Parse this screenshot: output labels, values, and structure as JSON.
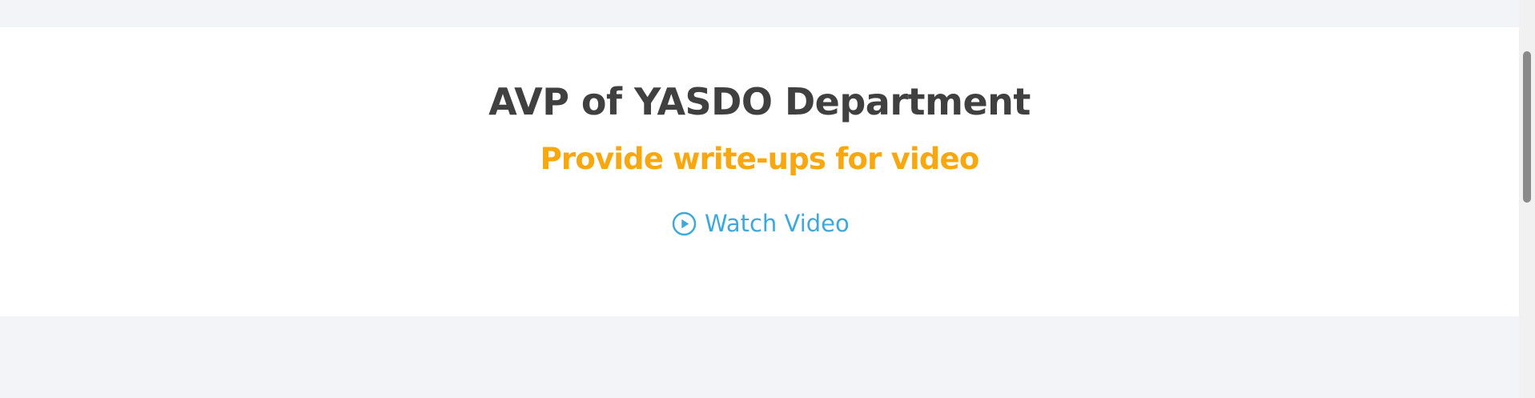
{
  "section": {
    "title": "AVP of YASDO Department",
    "subtitle": "Provide write-ups for video",
    "link": {
      "label": "Watch Video",
      "icon": "play-circle-icon"
    }
  },
  "colors": {
    "title": "#404040",
    "subtitle": "#f9a70f",
    "link": "#3ea8dc",
    "card_background": "#ffffff",
    "page_background": "#f3f4f8"
  }
}
